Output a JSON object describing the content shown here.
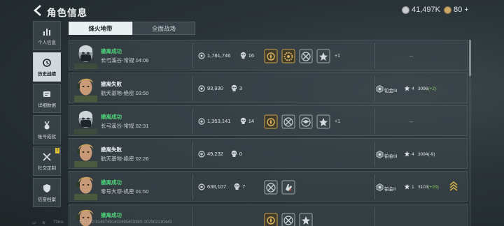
{
  "header": {
    "title": "角色信息",
    "silver": "41,497K",
    "gold": "80",
    "gold_plus": "+"
  },
  "sidebar": {
    "items": [
      {
        "label": "个人信息",
        "icon": "bar-chart-icon",
        "active": false
      },
      {
        "label": "历史战绩",
        "icon": "history-icon",
        "active": true
      },
      {
        "label": "详细数据",
        "icon": "data-icon",
        "active": false
      },
      {
        "label": "账号成就",
        "icon": "medal-icon",
        "active": false
      },
      {
        "label": "社交定制",
        "icon": "tools-icon",
        "active": false,
        "badge": "!"
      },
      {
        "label": "信誉档案",
        "icon": "shield-icon",
        "active": false
      }
    ]
  },
  "tabs": [
    {
      "label": "烽火地带",
      "active": true
    },
    {
      "label": "全面战场",
      "active": false
    }
  ],
  "matches": [
    {
      "result": "撤离成功",
      "outcome": "win",
      "map": "长弓溪谷-常规",
      "time": "04:08",
      "worth": "1,781,746",
      "kills": "16",
      "badges": [
        "gold-crest-badge",
        "gold-gear-badge",
        "crossed-tools-badge",
        "star-badge"
      ],
      "more": "+1",
      "rank": null,
      "rank_empty": "--",
      "avatar": "masked-operator"
    },
    {
      "result": "撤离失败",
      "outcome": "lose",
      "map": "航天基地-绝密",
      "time": "03:50",
      "worth": "93,930",
      "kills": "3",
      "badges": [],
      "more": "",
      "rank": {
        "name": "铂金III",
        "stars": "4",
        "score": "3096",
        "delta": "(+2)",
        "delta_sign": "pos"
      },
      "avatar": "blond-operator"
    },
    {
      "result": "撤离成功",
      "outcome": "win",
      "map": "长弓溪谷-常规",
      "time": "02:31",
      "worth": "1,353,141",
      "kills": "14",
      "badges": [
        "gold-crest-badge",
        "crossed-tools-badge",
        "eagle-badge",
        "star-badge"
      ],
      "more": "+1",
      "rank": null,
      "rank_empty": "--",
      "avatar": "masked-operator"
    },
    {
      "result": "撤离失败",
      "outcome": "lose",
      "map": "航天基地-绝密",
      "time": "02:26",
      "worth": "49,232",
      "kills": "0",
      "badges": [],
      "more": "",
      "rank": {
        "name": "铂金III",
        "stars": "4",
        "score": "3094",
        "delta": "(-9)",
        "delta_sign": "neg"
      },
      "avatar": "blond-operator"
    },
    {
      "result": "撤离成功",
      "outcome": "win",
      "map": "零号大坝-机密",
      "time": "01:50",
      "worth": "638,107",
      "kills": "7",
      "badges": [
        "crossed-tools-badge",
        "hand-badge"
      ],
      "more": "",
      "rank": {
        "name": "铂金II",
        "stars": "1",
        "score": "3103",
        "delta": "(+20)",
        "delta_sign": "pos",
        "chevron": true
      },
      "avatar": "blond-operator"
    },
    {
      "result": "撤离成功",
      "outcome": "win",
      "map": "",
      "time": "",
      "worth": "",
      "kills": "",
      "badges": [
        "gold-crest-badge",
        "crossed-tools-badge",
        "star-badge"
      ],
      "more": "",
      "rank": null,
      "rank_empty": "",
      "avatar": "blond-operator"
    }
  ],
  "footer": {
    "ping": "73ms",
    "uid": "CN UID:8149749140249540338S 202502130443"
  },
  "colors": {
    "success": "#4ed37a",
    "positive_delta": "#8bd16a",
    "active_tab": "#e9eef0",
    "gold_badge": "#c9a14a"
  }
}
